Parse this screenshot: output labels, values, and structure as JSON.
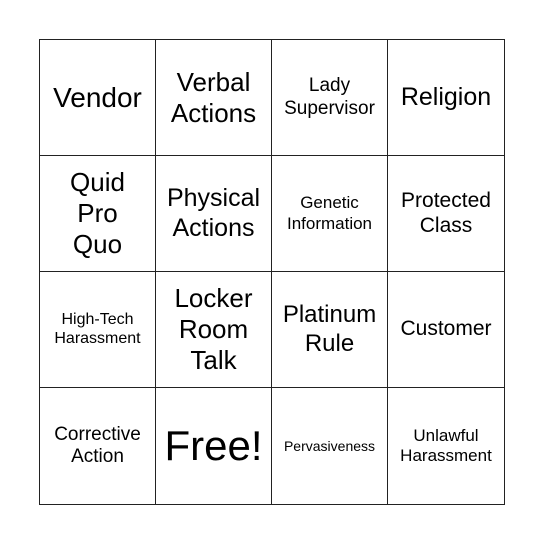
{
  "board": {
    "cells": [
      {
        "text": "Vendor"
      },
      {
        "text": "Verbal\nActions"
      },
      {
        "text": "Lady\nSupervisor"
      },
      {
        "text": "Religion"
      },
      {
        "text": "Quid\nPro\nQuo"
      },
      {
        "text": "Physical\nActions"
      },
      {
        "text": "Genetic\nInformation"
      },
      {
        "text": "Protected\nClass"
      },
      {
        "text": "High-Tech\nHarassment"
      },
      {
        "text": "Locker\nRoom\nTalk"
      },
      {
        "text": "Platinum\nRule"
      },
      {
        "text": "Customer"
      },
      {
        "text": "Corrective\nAction"
      },
      {
        "text": "Free!"
      },
      {
        "text": "Pervasiveness"
      },
      {
        "text": "Unlawful\nHarassment"
      }
    ]
  }
}
